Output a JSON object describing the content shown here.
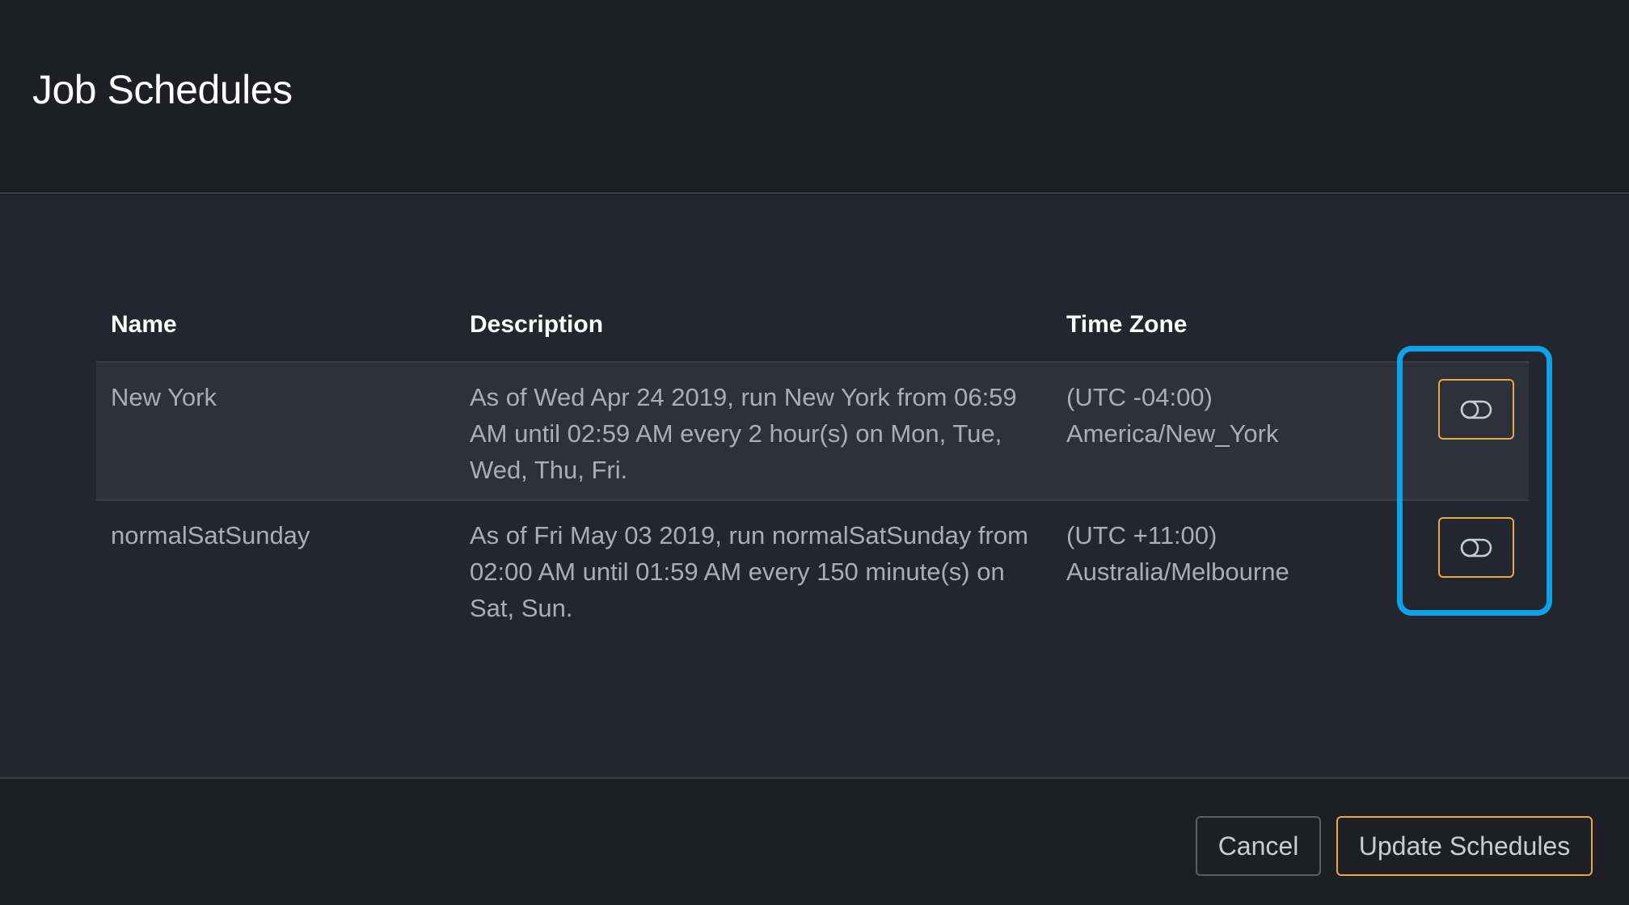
{
  "dialog": {
    "title": "Job Schedules"
  },
  "table": {
    "columns": [
      "Name",
      "Description",
      "Time Zone"
    ],
    "rows": [
      {
        "name": "New York",
        "description": "As of Wed Apr 24 2019, run New York from 06:59 AM until 02:59 AM every 2 hour(s) on Mon, Tue, Wed, Thu, Fri.",
        "timezone_offset": "(UTC -04:00)",
        "timezone_name": "America/New_York",
        "toggle_icon": "toggle-off-icon"
      },
      {
        "name": "normalSatSunday",
        "description": "As of Fri May 03 2019, run normalSatSunday from 02:00 AM until 01:59 AM every 150 minute(s) on Sat, Sun.",
        "timezone_offset": "(UTC +11:00)",
        "timezone_name": "Australia/Melbourne",
        "toggle_icon": "toggle-off-icon"
      }
    ]
  },
  "footer": {
    "cancel_label": "Cancel",
    "update_label": "Update Schedules"
  },
  "colors": {
    "background": "#1e1f24",
    "body_background": "#23262e",
    "row_highlight": "#2e3139",
    "accent_orange": "#e8a84a",
    "highlight_blue": "#0ea2e8",
    "muted_text": "#a9adb7"
  }
}
